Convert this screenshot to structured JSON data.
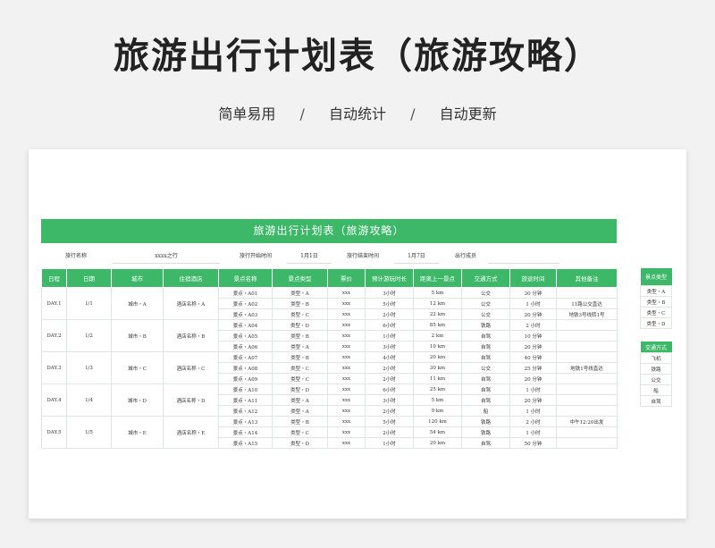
{
  "header": {
    "title": "旅游出行计划表（旅游攻略）",
    "features": [
      "简单易用",
      "自动统计",
      "自动更新"
    ],
    "separator": "/"
  },
  "sheet": {
    "banner": "旅游出行计划表（旅游攻略）",
    "info": {
      "trip_name_label": "旅行名称",
      "trip_name_value": "xxxx之行",
      "start_label": "旅行开始时间",
      "start_value": "1月1日",
      "end_label": "旅行结束时间",
      "end_value": "1月7日",
      "members_label": "出行成员",
      "members_value": ""
    },
    "columns": [
      "日程",
      "日期",
      "城市",
      "住宿酒店",
      "景点名称",
      "景点类型",
      "票价",
      "预计游玩时长",
      "距离上一景点",
      "交通方式",
      "旅途时间",
      "其他备注"
    ],
    "days": [
      {
        "day": "DAY.1",
        "date": "1/1",
        "city": "城市・A",
        "hotel": "酒店名称・A",
        "rows": [
          [
            "景点・A01",
            "类型・A",
            "xxx",
            "3小时",
            "5  km",
            "公交",
            "30 分钟",
            ""
          ],
          [
            "景点・A02",
            "类型・B",
            "xxx",
            "5小时",
            "12 km",
            "公交",
            "1 小时",
            "11路公交直达"
          ],
          [
            "景点・A03",
            "类型・C",
            "xxx",
            "2小时",
            "22 km",
            "公交",
            "20 分钟",
            "地铁3号线转1号"
          ]
        ]
      },
      {
        "day": "DAY.2",
        "date": "1/2",
        "city": "城市・B",
        "hotel": "酒店名称・B",
        "rows": [
          [
            "景点・A04",
            "类型・D",
            "xxx",
            "6小时",
            "85 km",
            "铁路",
            "2 小时",
            ""
          ],
          [
            "景点・A05",
            "类型・B",
            "xxx",
            "1小时",
            "2  km",
            "自驾",
            "10 分钟",
            ""
          ],
          [
            "景点・A06",
            "类型・A",
            "xxx",
            "3小时",
            "10 km",
            "自驾",
            "20 分钟",
            ""
          ]
        ]
      },
      {
        "day": "DAY.3",
        "date": "1/3",
        "city": "城市・C",
        "hotel": "酒店名称・C",
        "rows": [
          [
            "景点・A07",
            "类型・B",
            "xxx",
            "4小时",
            "20 km",
            "自驾",
            "40 分钟",
            ""
          ],
          [
            "景点・A08",
            "类型・C",
            "xxx",
            "2小时",
            "30 km",
            "公交",
            "25 分钟",
            "地铁1号线直达"
          ],
          [
            "景点・A09",
            "类型・C",
            "xxx",
            "2小时",
            "11 km",
            "自驾",
            "20 分钟",
            ""
          ]
        ]
      },
      {
        "day": "DAY.4",
        "date": "1/4",
        "city": "城市・D",
        "hotel": "酒店名称・D",
        "rows": [
          [
            "景点・A10",
            "类型・D",
            "xxx",
            "6小时",
            "25 km",
            "自驾",
            "1 小时",
            ""
          ],
          [
            "景点・A11",
            "类型・A",
            "xxx",
            "3小时",
            "5  km",
            "自驾",
            "20 分钟",
            ""
          ],
          [
            "景点・A12",
            "类型・A",
            "xxx",
            "2小时",
            "9  km",
            "船",
            "1 小时",
            ""
          ]
        ]
      },
      {
        "day": "DAY.5",
        "date": "1/5",
        "city": "城市・E",
        "hotel": "酒店名称・E",
        "rows": [
          [
            "景点・A13",
            "类型・B",
            "xxx",
            "5小时",
            "120 km",
            "铁路",
            "2 小时",
            "中午12:20出发"
          ],
          [
            "景点・A14",
            "类型・C",
            "xxx",
            "2小时",
            "54 km",
            "铁路",
            "1 小时",
            ""
          ],
          [
            "景点・A15",
            "类型・D",
            "xxx",
            "1小时",
            "20 km",
            "自驾",
            "50 分钟",
            ""
          ]
        ]
      }
    ],
    "side_types": {
      "header": "景点类型",
      "items": [
        "类型・A",
        "类型・B",
        "类型・C",
        "类型・D"
      ]
    },
    "side_transport": {
      "header": "交通方式",
      "items": [
        "飞机",
        "铁路",
        "公交",
        "船",
        "自驾"
      ]
    }
  },
  "colors": {
    "accent": "#3cb868",
    "background": "#f2f2f2"
  }
}
